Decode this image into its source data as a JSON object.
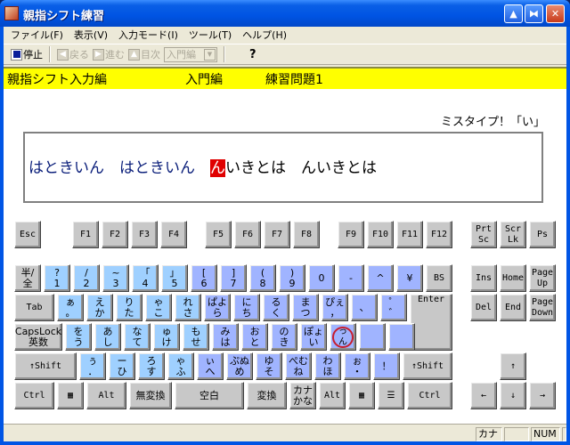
{
  "window": {
    "title": "親指シフト練習"
  },
  "menu": [
    "ファイル(F)",
    "表示(V)",
    "入力モード(I)",
    "ツール(T)",
    "ヘルプ(H)"
  ],
  "toolbar": {
    "stop": "停止",
    "back": "戻る",
    "forward": "進む",
    "index": "目次",
    "select_value": "入門編",
    "help": "?"
  },
  "header": {
    "course": "親指シフト入力編",
    "level": "入門編",
    "exercise": "練習問題1"
  },
  "miss_message": "ミスタイプ！「い」",
  "practice": {
    "typed": "はときいん　はときいん　",
    "current": "ん",
    "remaining": "いきとは　んいきとは"
  },
  "keys": {
    "esc": "Esc",
    "f": [
      "F1",
      "F2",
      "F3",
      "F4",
      "F5",
      "F6",
      "F7",
      "F8",
      "F9",
      "F10",
      "F11",
      "F12"
    ],
    "prtsc": [
      "Prt",
      "Sc"
    ],
    "scrlk": [
      "Scr",
      "Lk"
    ],
    "ps": "Ps",
    "row1": [
      [
        "半/",
        "全"
      ],
      [
        "?",
        "1"
      ],
      [
        "/",
        "2"
      ],
      [
        "~",
        "3"
      ],
      [
        "「",
        "4"
      ],
      [
        "」",
        "5"
      ],
      [
        "[",
        "6"
      ],
      [
        "]",
        "7"
      ],
      [
        "(",
        "8"
      ],
      [
        ")",
        "9"
      ],
      [
        "",
        "0"
      ],
      [
        "",
        "-"
      ],
      [
        "",
        "^"
      ],
      [
        "",
        "¥"
      ]
    ],
    "bs": "BS",
    "tab": "Tab",
    "row2": [
      [
        "ぁ",
        "。"
      ],
      [
        "え",
        "か"
      ],
      [
        "り",
        "た"
      ],
      [
        "ゃ",
        "こ"
      ],
      [
        "れ",
        "さ"
      ],
      [
        "ぱよ",
        "ら"
      ],
      [
        "に",
        "ち"
      ],
      [
        "る",
        "く"
      ],
      [
        "ま",
        "つ"
      ],
      [
        "ぴぇ",
        "，"
      ],
      [
        "",
        "、"
      ],
      [
        "゜",
        "゛"
      ]
    ],
    "enter": "Enter",
    "caps": [
      "CapsLock",
      "英数"
    ],
    "row3": [
      [
        "を",
        "う"
      ],
      [
        "あ",
        "し"
      ],
      [
        "な",
        "て"
      ],
      [
        "ゅ",
        "け"
      ],
      [
        "も",
        "せ"
      ],
      [
        "み",
        "は"
      ],
      [
        "お",
        "と"
      ],
      [
        "の",
        "き"
      ],
      [
        "ぽょ",
        "い"
      ],
      [
        "っ",
        "ん"
      ],
      [
        "",
        ""
      ],
      [
        "",
        ""
      ]
    ],
    "lshift": "↑Shift",
    "row4": [
      [
        "ぅ",
        "．"
      ],
      [
        "ー",
        "ひ"
      ],
      [
        "ろ",
        "す"
      ],
      [
        "ゃ",
        "ふ"
      ],
      [
        "ぃ",
        "へ"
      ],
      [
        "ぷぬ",
        "め"
      ],
      [
        "ゆ",
        "そ"
      ],
      [
        "ぺむ",
        "ね"
      ],
      [
        "わ",
        "ほ"
      ],
      [
        "ぉ",
        "・"
      ],
      [
        "",
        "！"
      ]
    ],
    "rshift": "↑Shift",
    "ctrl": "Ctrl",
    "alt": "Alt",
    "muhenkan": "無変換",
    "space": "空白",
    "henkan": "変換",
    "kana": [
      "カナ",
      "かな"
    ],
    "ins": "Ins",
    "home": "Home",
    "pgup": [
      "Page",
      "Up"
    ],
    "del": "Del",
    "end": "End",
    "pgdn": [
      "Page",
      "Down"
    ],
    "up": "↑",
    "left": "←",
    "down": "↓",
    "right": "→",
    "win": "▦",
    "menu": "☰"
  },
  "status": {
    "kana": "カナ",
    "cell2": "",
    "num": "NUM",
    "cell4": ""
  }
}
